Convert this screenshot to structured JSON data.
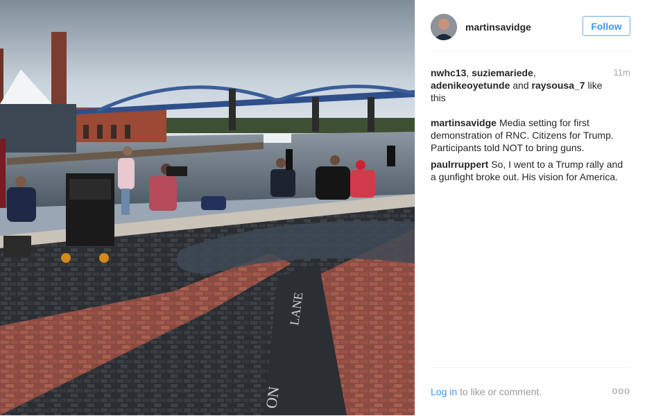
{
  "header": {
    "username": "martinsavidge",
    "follow_label": "Follow"
  },
  "likes": {
    "users": [
      "nwhc13",
      "suziemariede",
      "adenikeoyetunde",
      "raysousa_7"
    ],
    "suffix": "like this",
    "time": "11m"
  },
  "comments": [
    {
      "user": "martinsavidge",
      "text": "Media setting for first demonstration of RNC. Citizens for Trump. Participants told NOT to bring guns."
    },
    {
      "user": "paulrruppert",
      "text": "So, I went to a Trump rally and a gunfight broke out. His vision for America."
    }
  ],
  "footer": {
    "login_link": "Log in",
    "login_text": "to like or comment.",
    "more_label": "ooo"
  },
  "photo": {
    "engraved_word_1": "LANE",
    "engraved_word_2": "ON"
  }
}
